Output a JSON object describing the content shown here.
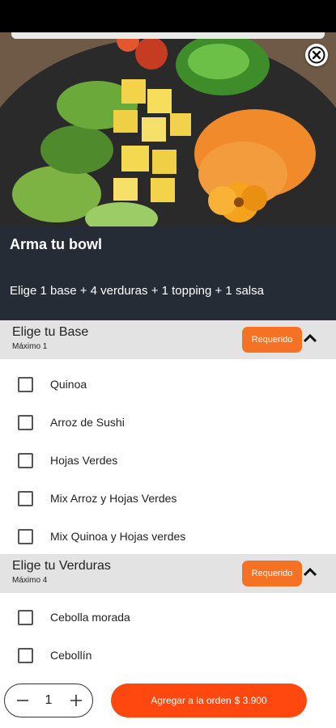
{
  "product": {
    "title": "Arma tu bowl",
    "description": "Elige 1 base + 4 verduras + 1 topping + 1 salsa"
  },
  "sections": [
    {
      "title": "Elige tu Base",
      "subtitle": "Máximo 1",
      "badge": "Requerido",
      "options": [
        "Quinoa",
        "Arroz de Sushi",
        "Hojas Verdes",
        "Mix Arroz y Hojas Verdes",
        "Mix Quinoa y Hojas verdes"
      ]
    },
    {
      "title": "Elige tu Verduras",
      "subtitle": "Máximo 4",
      "badge": "Requerido",
      "options": [
        "Cebolla morada",
        "Cebollín"
      ]
    }
  ],
  "cart": {
    "quantity": "1",
    "add_label": "Agregar a la orden",
    "price": "$ 3.900"
  },
  "icons": {
    "close": "close-icon",
    "collapse": "chevron-up-icon",
    "minus": "minus-icon",
    "plus": "plus-icon"
  },
  "colors": {
    "accent": "#f57224",
    "cta": "#ff4810",
    "info_bg": "#252c36",
    "section_bg": "#e3e3e3"
  }
}
